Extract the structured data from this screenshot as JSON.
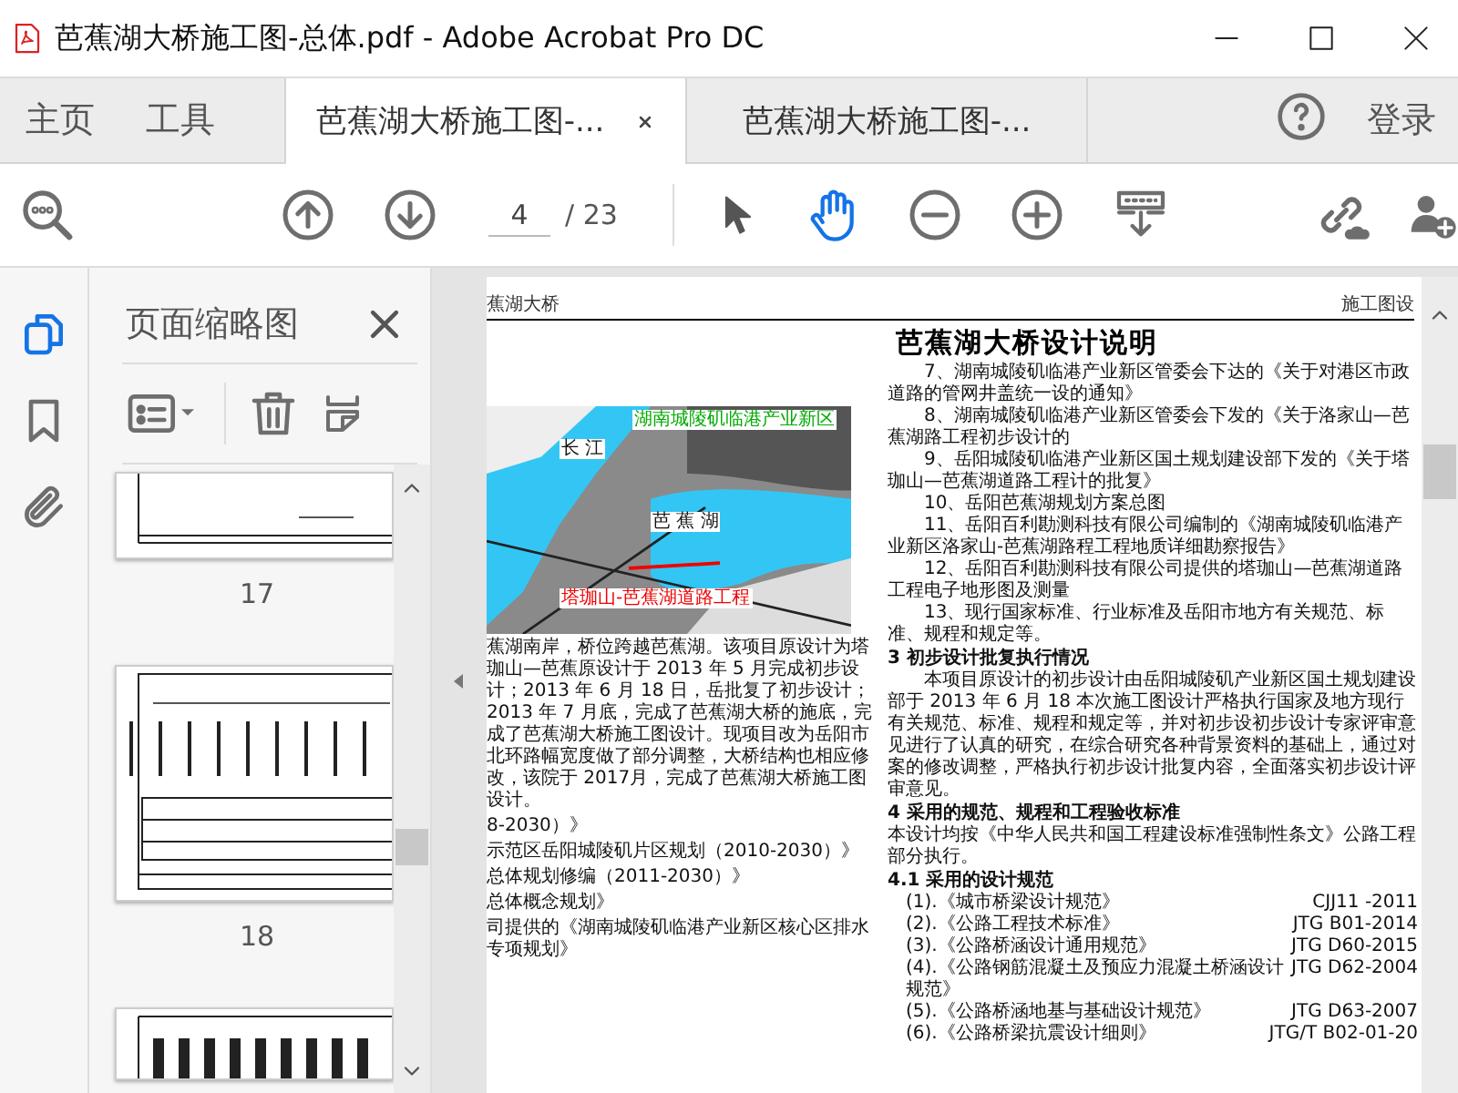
{
  "window": {
    "title": "芭蕉湖大桥施工图-总体.pdf - Adobe Acrobat Pro DC"
  },
  "nav": [
    {
      "label": "主页",
      "selected": false
    },
    {
      "label": "工具",
      "selected": false
    }
  ],
  "doc_tabs": [
    {
      "label": "芭蕉湖大桥施工图-...",
      "selected": true
    },
    {
      "label": "芭蕉湖大桥施工图-...",
      "selected": false
    }
  ],
  "sign_in": "登录",
  "toolbar": {
    "page": "4",
    "total": "/ 23",
    "tools": [
      {
        "kind": "select",
        "selected": false
      },
      {
        "kind": "hand",
        "selected": true
      }
    ]
  },
  "rail": [
    {
      "kind": "pages",
      "selected": true
    },
    {
      "kind": "bookmarks",
      "selected": false
    },
    {
      "kind": "attachments",
      "selected": false
    }
  ],
  "panel": {
    "title": "页面缩略图",
    "thumbnails": [
      {
        "kind": "partial-top",
        "label": "17"
      },
      {
        "kind": "full",
        "label": "18"
      },
      {
        "kind": "partial-bottom"
      }
    ]
  },
  "document": {
    "header_left": "蕉湖大桥",
    "header_right": "施工图设",
    "title": "芭蕉湖大桥设计说明",
    "map_labels": [
      "长 江",
      "湖南城陵矶临港产业新区",
      "芭 蕉 湖",
      "塔珈山-芭蕉湖道路工程"
    ],
    "left_paragraph": "蕉湖南岸，桥位跨越芭蕉湖。该项目原设计为塔珈山—芭蕉原设计于 2013 年 5 月完成初步设计；2013 年 6 月 18 日，岳批复了初步设计； 2013 年 7 月底，完成了芭蕉湖大桥的施底，完成了芭蕉湖大桥施工图设计。现项目改为岳阳市北环路幅宽度做了部分调整，大桥结构也相应修改，该院于 2017月，完成了芭蕉湖大桥施工图设计。",
    "left_refs": [
      "8-2030）》",
      "示范区岳阳城陵矶片区规划（2010-2030）》",
      "总体规划修编（2011-2030）》",
      "总体概念规划》",
      "司提供的《湖南城陵矶临港产业新区核心区排水专项规划》"
    ],
    "right": [
      {
        "kind": "item",
        "text": "7、湖南城陵矶临港产业新区管委会下达的《关于对港区市政道路的管网井盖统一设的通知》"
      },
      {
        "kind": "item",
        "text": "8、湖南城陵矶临港产业新区管委会下发的《关于洛家山—芭蕉湖路工程初步设计的"
      },
      {
        "kind": "item",
        "text": "9、岳阳城陵矶临港产业新区国土规划建设部下发的《关于塔珈山—芭蕉湖道路工程计的批复》"
      },
      {
        "kind": "item",
        "text": "10、岳阳芭蕉湖规划方案总图"
      },
      {
        "kind": "item",
        "text": "11、岳阳百利勘测科技有限公司编制的《湖南城陵矶临港产业新区洛家山-芭蕉湖路程工程地质详细勘察报告》"
      },
      {
        "kind": "item",
        "text": "12、岳阳百利勘测科技有限公司提供的塔珈山—芭蕉湖道路工程电子地形图及测量"
      },
      {
        "kind": "item",
        "text": "13、现行国家标准、行业标准及岳阳市地方有关规范、标准、规程和规定等。"
      },
      {
        "kind": "heading",
        "text": "3 初步设计批复执行情况"
      },
      {
        "kind": "para",
        "text": "本项目原设计的初步设计由岳阳城陵矶产业新区国土规划建设部于 2013 年 6 月 18 本次施工图设计严格执行国家及地方现行有关规范、标准、规程和规定等，并对初步设初步设计专家评审意见进行了认真的研究，在综合研究各种背景资料的基础上，通过对案的修改调整，严格执行初步设计批复内容，全面落实初步设计评审意见。"
      },
      {
        "kind": "heading",
        "text": "4 采用的规范、规程和工程验收标准"
      },
      {
        "kind": "plain",
        "text": "本设计均按《中华人民共和国工程建设标准强制性条文》公路工程部分执行。"
      },
      {
        "kind": "subheading",
        "text": "4.1 采用的设计规范"
      }
    ],
    "standards": [
      {
        "name": "(1).《城市桥梁设计规范》",
        "code": "CJJ11 -2011"
      },
      {
        "name": "(2).《公路工程技术标准》",
        "code": "JTG B01-2014"
      },
      {
        "name": "(3).《公路桥涵设计通用规范》",
        "code": "JTG D60-2015"
      },
      {
        "name": "(4).《公路钢筋混凝土及预应力混凝土桥涵设计规范》",
        "code": "JTG D62-2004"
      },
      {
        "name": "(5).《公路桥涵地基与基础设计规范》",
        "code": "JTG D63-2007"
      },
      {
        "name": "(6).《公路桥梁抗震设计细则》",
        "code": "JTG/T B02-01-20"
      }
    ]
  }
}
